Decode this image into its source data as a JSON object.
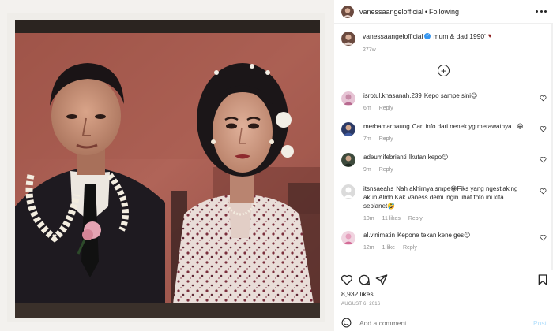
{
  "header": {
    "username": "vanessaangelofficial",
    "separator": "•",
    "follow_status": "Following"
  },
  "caption": {
    "username": "vanessaangelofficial",
    "text": "mum & dad 1990'",
    "time": "277w"
  },
  "comments": [
    {
      "user": "isrotul.khasanah.239",
      "text": "Kepo sampe sini😉",
      "time": "6m",
      "likes": "",
      "reply": "Reply"
    },
    {
      "user": "merbamarpaung",
      "text": "Cari info dari nenek yg merawatnya...😁",
      "time": "7m",
      "likes": "",
      "reply": "Reply"
    },
    {
      "user": "adeumifebrianti",
      "text": "Ikutan kepo😉",
      "time": "9m",
      "likes": "",
      "reply": "Reply"
    },
    {
      "user": "itsnsaeahs",
      "text": "Nah akhirnya smpe😁Fiks yang ngestlaking akun Almh Kak Vaness demi ingin lihat foto ini kita seplanet🤣",
      "time": "10m",
      "likes": "11 likes",
      "reply": "Reply"
    },
    {
      "user": "al.vinimatin",
      "text": "Kepone tekan kene ges😉",
      "time": "12m",
      "likes": "1 like",
      "reply": "Reply"
    }
  ],
  "likes_count": "8,932 likes",
  "date": "AUGUST 6, 2016",
  "add_comment": {
    "placeholder": "Add a comment..."
  },
  "post_label": "Post",
  "colors": {
    "verified": "#3897f0",
    "post_disabled": "#b2dffc",
    "meta": "#8e8e8e"
  },
  "icons": [
    "more-options-icon",
    "load-more-comments-icon",
    "heart-icon",
    "comment-icon",
    "share-icon",
    "save-icon",
    "emoji-icon",
    "verified-icon"
  ]
}
